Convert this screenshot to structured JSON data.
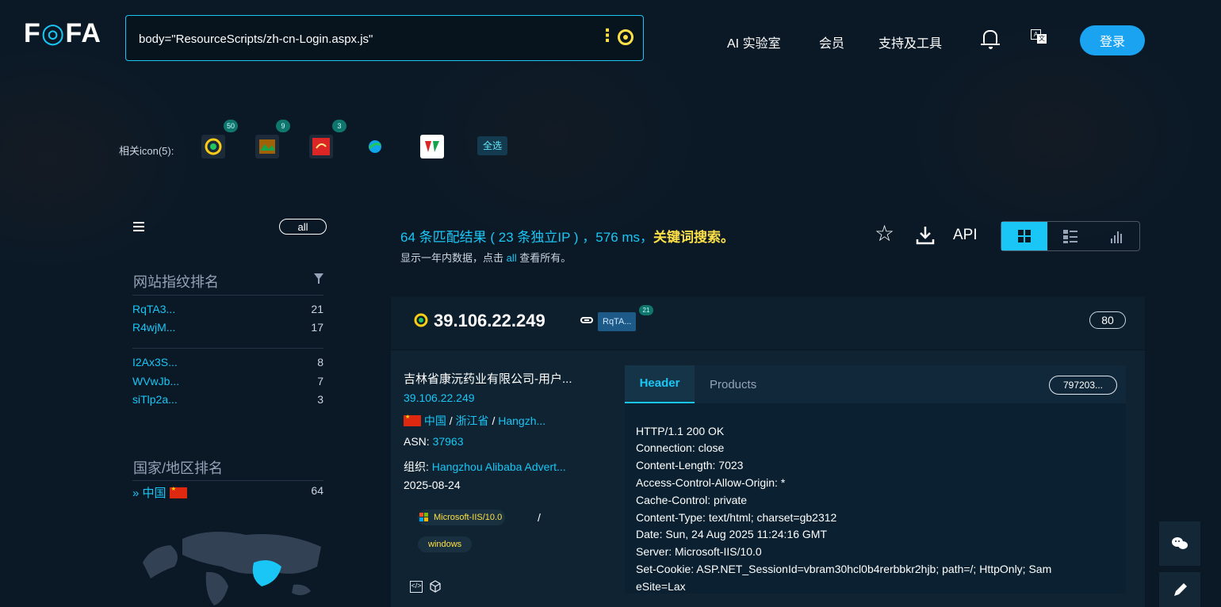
{
  "header": {
    "logo": "FOFA",
    "search_query": "body=\"ResourceScripts/zh-cn-Login.aspx.js\"",
    "nav": [
      "AI 实验室",
      "会员",
      "支持及工具"
    ],
    "login_label": "登录"
  },
  "related_icons": {
    "label": "相关icon(5):",
    "badges": [
      "50",
      "9",
      "3"
    ],
    "select_all": "全选"
  },
  "sidebar": {
    "all_label": "all",
    "fingerprint_title": "网站指纹排名",
    "fingerprints": [
      {
        "name": "RqTA3...",
        "count": "21"
      },
      {
        "name": "R4wjM...",
        "count": "17"
      },
      {
        "name": "I2Ax3S...",
        "count": "8"
      },
      {
        "name": "WVwJb...",
        "count": "7"
      },
      {
        "name": "siTlp2a...",
        "count": "3"
      }
    ],
    "country_title": "国家/地区排名",
    "country": {
      "prefix": "»",
      "name": "中国",
      "count": "64"
    }
  },
  "summary": {
    "count": "64",
    "text1": " 条匹配结果 ( ",
    "unique": "23",
    "text2": " 条独立IP ) ，",
    "ms": "576",
    "text3": " ms，",
    "keyword": "关键词搜索。",
    "line2a": "显示一年内数据，点击 ",
    "line2b": "all",
    "line2c": " 查看所有。"
  },
  "toolbar": {
    "api_label": "API"
  },
  "result": {
    "ip": "39.106.22.249",
    "tag": "RqTA...",
    "tag_badge": "21",
    "port": "80",
    "org_title": "吉林省康沅药业有限公司-用户...",
    "ip_small": "39.106.22.249",
    "country": "中国",
    "province": "浙江省",
    "city": "Hangzh...",
    "asn_label": "ASN: ",
    "asn": "37963",
    "org_label": "组织: ",
    "org": "Hangzhou Alibaba Advert...",
    "date": "2025-08-24",
    "server": "Microsoft-IIS/10.0",
    "os": "windows",
    "tabs": {
      "header": "Header",
      "products": "Products"
    },
    "hash": "797203...",
    "headers": [
      "HTTP/1.1 200 OK",
      "Connection: close",
      "Content-Length: 7023",
      "Access-Control-Allow-Origin: *",
      "Cache-Control: private",
      "Content-Type: text/html; charset=gb2312",
      "Date: Sun, 24 Aug 2025 11:24:16 GMT",
      "Server: Microsoft-IIS/10.0",
      "Set-Cookie: ASP.NET_SessionId=vbram30hcl0b4rerbbkr2hjb; path=/; HttpOnly; Sam",
      "eSite=Lax"
    ]
  },
  "colors": {
    "accent": "#19c6f5",
    "highlight": "#fde047",
    "background": "#0b1926"
  }
}
